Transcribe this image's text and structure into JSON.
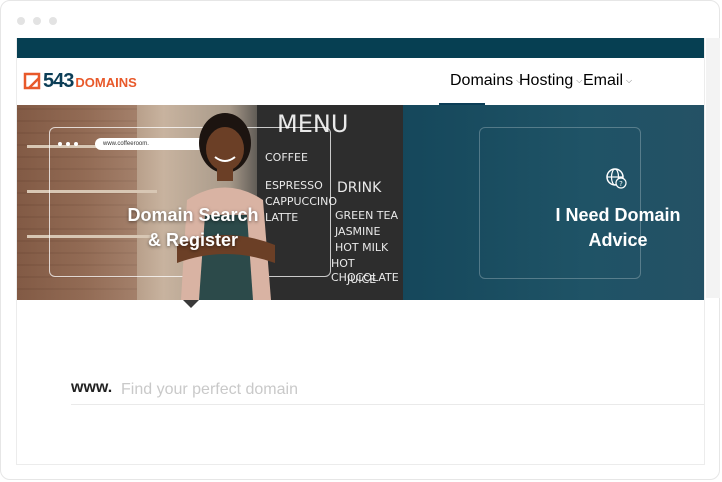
{
  "brand": {
    "logo_number": "543",
    "logo_word": "DOMAINS",
    "primary_color": "#0c3e57",
    "accent_color": "#e8592a"
  },
  "nav": {
    "items": [
      {
        "label": "Domains"
      },
      {
        "label": "Hosting"
      },
      {
        "label": "Email"
      }
    ],
    "chevron": "⌵"
  },
  "hero": {
    "left_title_line1": "Domain Search",
    "left_title_line2": "& Register",
    "right_title_line1": "I Need Domain",
    "right_title_line2": "Advice",
    "mock_url": "www.coffeeroom.",
    "board_lines": [
      "COFFEE",
      "ESPRESSO",
      "CAPPUCCINO",
      "LATTE",
      "",
      "DRINK",
      "GREEN TEA",
      "JASMINE",
      "HOT MILK",
      "HOT CHOCOLATE",
      "JUICE"
    ],
    "board_heading": "MENU"
  },
  "search": {
    "prefix": "www.",
    "placeholder": "Find your perfect domain",
    "value": ""
  }
}
